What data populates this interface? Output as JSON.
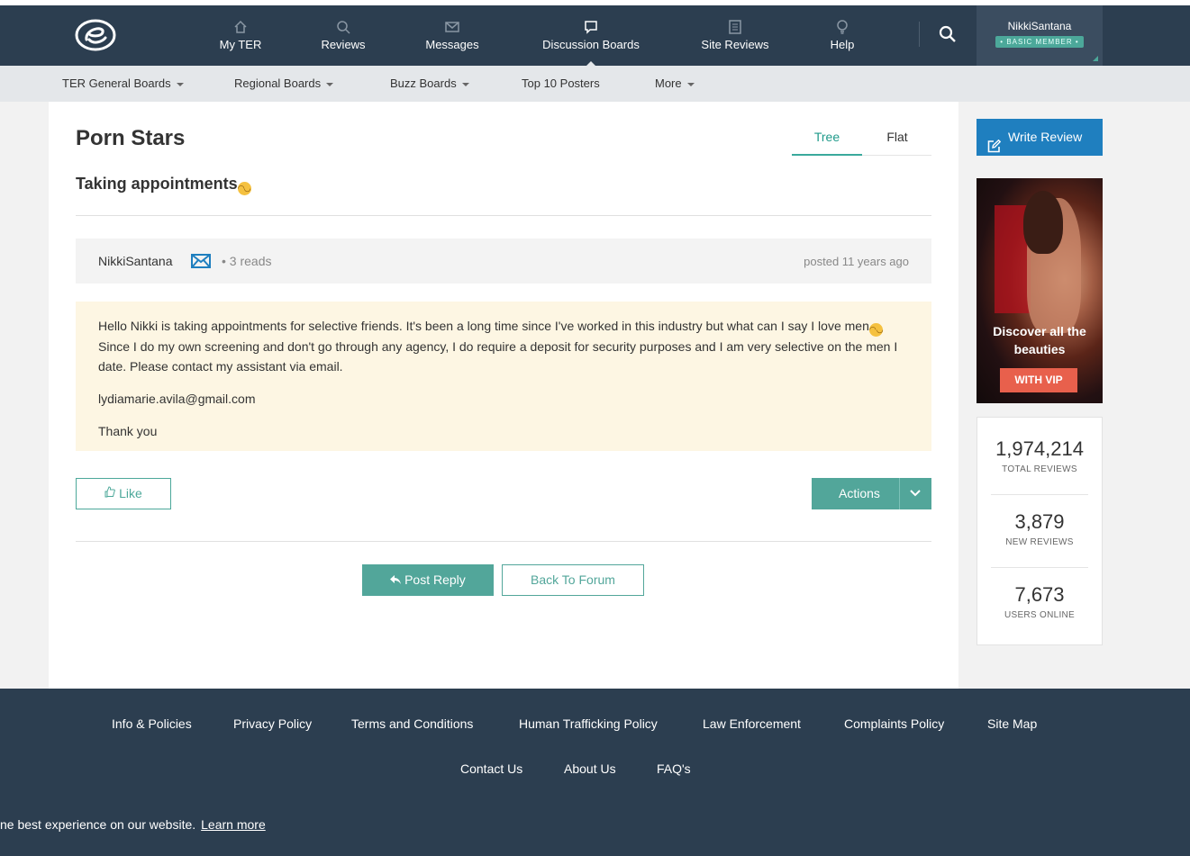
{
  "header": {
    "nav": [
      {
        "label": "My TER",
        "icon": "home-icon"
      },
      {
        "label": "Reviews",
        "icon": "search-icon"
      },
      {
        "label": "Messages",
        "icon": "envelope-icon"
      },
      {
        "label": "Discussion Boards",
        "icon": "chat-bubble-icon"
      },
      {
        "label": "Site Reviews",
        "icon": "document-icon"
      },
      {
        "label": "Help",
        "icon": "lightbulb-icon"
      }
    ],
    "active_nav": "Discussion Boards",
    "user": {
      "name": "NikkiSantana",
      "badge": "• BASIC MEMBER •"
    }
  },
  "subnav": {
    "items": [
      {
        "label": "TER General Boards",
        "dropdown": true
      },
      {
        "label": "Regional Boards",
        "dropdown": true
      },
      {
        "label": "Buzz Boards",
        "dropdown": true
      },
      {
        "label": "Top 10 Posters",
        "dropdown": false
      },
      {
        "label": "More",
        "dropdown": true
      }
    ]
  },
  "board": {
    "title": "Porn Stars",
    "tabs": {
      "tree": "Tree",
      "flat": "Flat"
    },
    "active_tab": "Tree"
  },
  "thread": {
    "title": "Taking appointments",
    "post": {
      "author": "NikkiSantana",
      "reads": "3 reads",
      "posted": "posted 11 years ago",
      "body_line1a": "Hello Nikki is taking appointments for selective friends.  It's been a long time since I've worked in this industry but what can I say I love men",
      "body_line1b": " Since I do my own screening and don't go through any agency, I do require a deposit for security purposes and I am very selective on the men I date.  Please contact my assistant via email.",
      "email": "lydiamarie.avila@gmail.com",
      "closing": "Thank you"
    },
    "like_label": "Like",
    "actions_label": "Actions",
    "post_reply_label": "Post Reply",
    "back_label": "Back To Forum"
  },
  "sidebar": {
    "write_review_label": "Write Review",
    "ad": {
      "text": "Discover all the beauties",
      "cta": "WITH VIP"
    },
    "stats": [
      {
        "value": "1,974,214",
        "label": "TOTAL REVIEWS"
      },
      {
        "value": "3,879",
        "label": "NEW REVIEWS"
      },
      {
        "value": "7,673",
        "label": "USERS ONLINE"
      }
    ]
  },
  "footer": {
    "row1": [
      "Info & Policies",
      "Privacy Policy",
      "Terms and Conditions",
      "Human Trafficking Policy",
      "Law Enforcement",
      "Complaints Policy",
      "Site Map"
    ],
    "row2": [
      "Contact Us",
      "About Us",
      "FAQ's"
    ],
    "cookie_text": "ne best experience on our website.",
    "cookie_link": "Learn more"
  },
  "colors": {
    "nav_bg": "#2c3e50",
    "accent_teal": "#52a69a",
    "write_review_blue": "#1f7fbf",
    "post_bg": "#fdf6e3",
    "vip_orange": "#e8604c"
  }
}
